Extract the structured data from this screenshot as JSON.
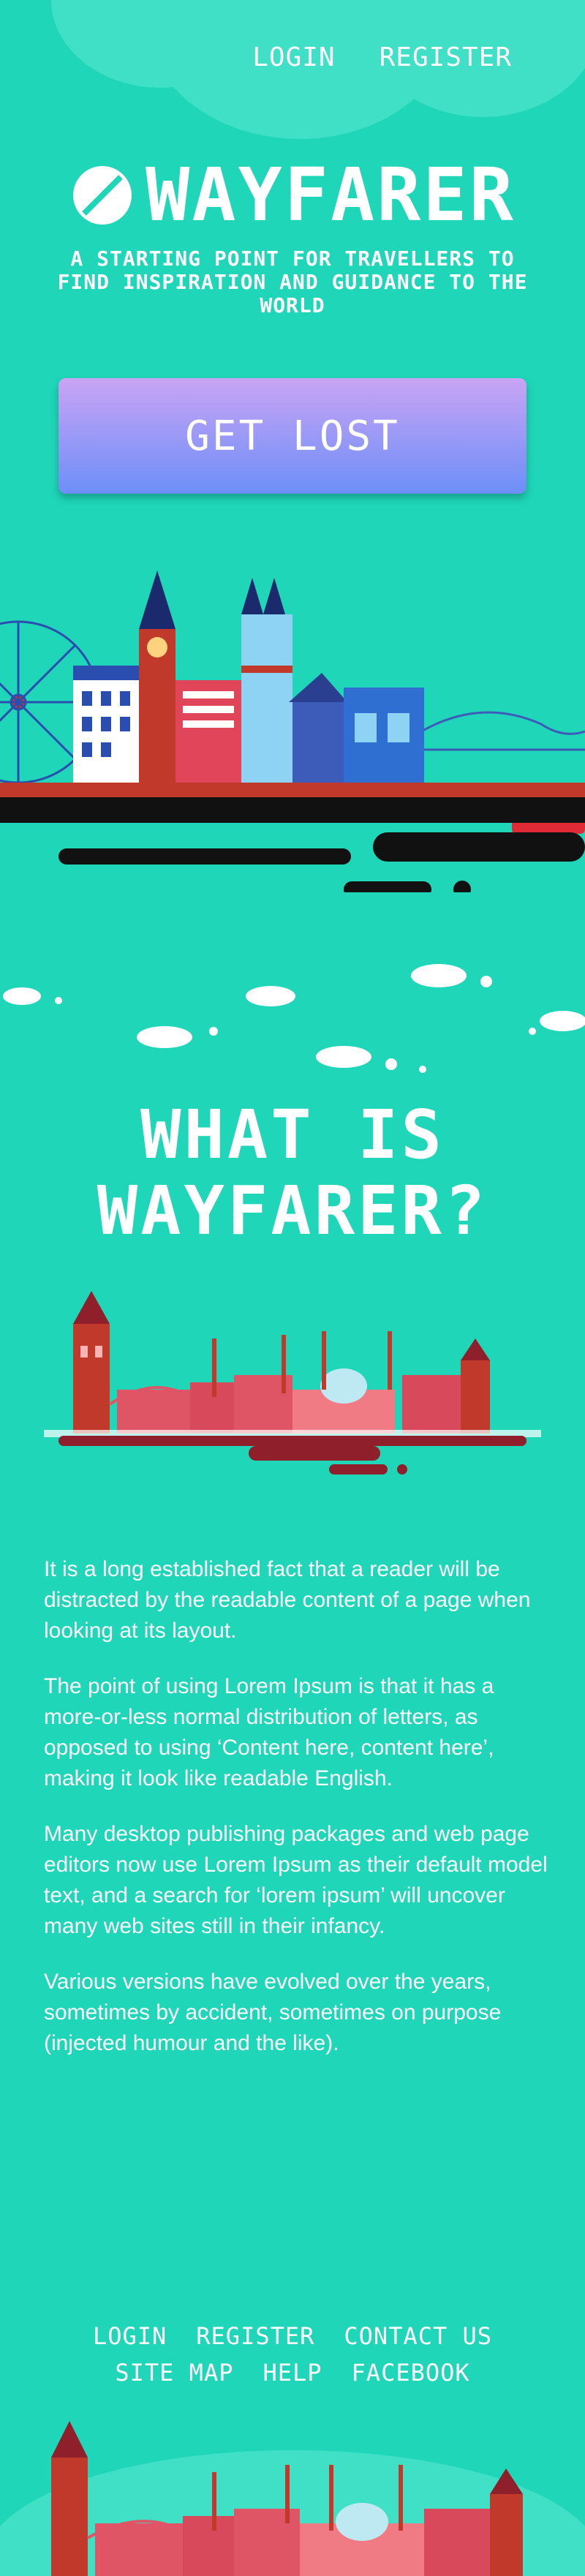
{
  "header": {
    "nav": {
      "login": "LOGIN",
      "register": "REGISTER"
    }
  },
  "hero": {
    "title": "WAYFARER",
    "tagline": "A STARTING POINT FOR TRAVELLERS TO FIND INSPIRATION AND GUIDANCE TO THE WORLD",
    "cta_label": "GET LOST"
  },
  "about": {
    "title_line1": "WHAT IS",
    "title_line2": "WAYFARER?",
    "paragraphs": [
      "It is a long established fact that a reader will be distracted by the readable content of a page when looking at its layout.",
      "The point of using Lorem Ipsum is that it has a more-or-less normal distribution of letters, as opposed to using ‘Content here, content here’, making it look like readable English.",
      "Many desktop publishing packages and web page editors now use Lorem Ipsum as their default model text, and a search for ‘lorem ipsum’ will uncover many web sites still in their infancy.",
      "Various versions have evolved over the years, sometimes by accident, sometimes on purpose (injected humour and the like)."
    ]
  },
  "footer": {
    "row1": [
      "LOGIN",
      "REGISTER",
      "CONTACT US"
    ],
    "row2": [
      "SITE MAP",
      "HELP",
      "FACEBOOK"
    ]
  },
  "colors": {
    "background": "#1fd6b8",
    "cta_top": "#c9a4f5",
    "cta_bottom": "#6c8ff7",
    "road": "#111111",
    "brick": "#c0392b"
  },
  "icons": {
    "logo": "compass-icon"
  }
}
